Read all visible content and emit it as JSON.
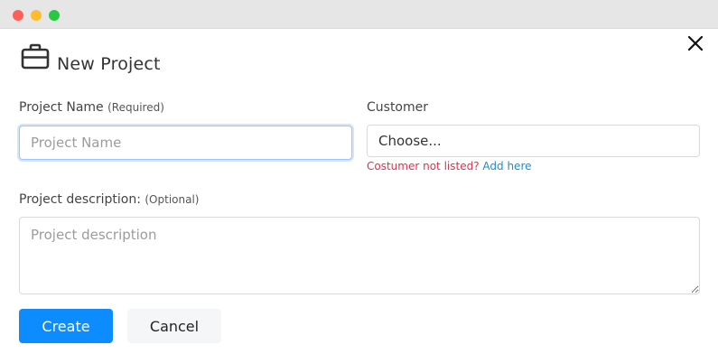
{
  "window": {
    "controls": [
      "close",
      "minimize",
      "maximize"
    ]
  },
  "dialog": {
    "title": "New Project",
    "icon": "briefcase-icon",
    "close_icon": "close-icon"
  },
  "form": {
    "project_name": {
      "label": "Project Name",
      "qualifier": "(Required)",
      "placeholder": "Project Name",
      "value": ""
    },
    "customer": {
      "label": "Customer",
      "selected": "Choose...",
      "hint_text": "Costumer not listed?",
      "hint_link": "Add here"
    },
    "description": {
      "label": "Project description:",
      "qualifier": "(Optional)",
      "placeholder": "Project description",
      "value": ""
    }
  },
  "actions": {
    "create_label": "Create",
    "cancel_label": "Cancel"
  },
  "colors": {
    "primary": "#0d8cff",
    "warning": "#e0324b",
    "link": "#1a8cd8"
  }
}
